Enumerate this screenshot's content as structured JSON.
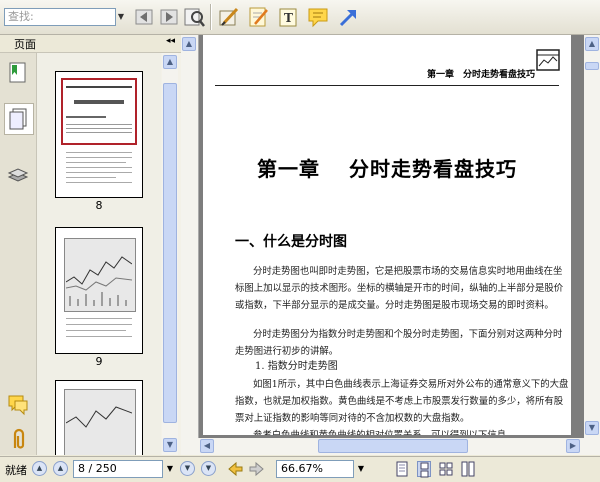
{
  "toolbar": {
    "search_placeholder": "查找:",
    "icons": [
      "search-prev-icon",
      "search-next-icon",
      "find-icon",
      "edit-tool-icon",
      "note-pad-icon",
      "text-tool-icon",
      "comment-icon",
      "arrow-tool-icon"
    ]
  },
  "sidebar": {
    "title": "页面",
    "collapse_glyph": "◂◂",
    "thumbnails": [
      {
        "label": "8"
      },
      {
        "label": "9"
      }
    ]
  },
  "document": {
    "running_header": "第一章　分时走势看盘技巧",
    "chapter_title": "第一章　 分时走势看盘技巧",
    "section_heading": "一、什么是分时图",
    "paragraphs": [
      "分时走势图也叫即时走势图，它是把股票市场的交易信息实时地用曲线在坐标图上加以显示的技术图形。坐标的横轴是开市的时间，纵轴的上半部分是股价或指数，下半部分显示的是成交量。分时走势图是股市现场交易的即时资料。",
      "分时走势图分为指数分时走势图和个股分时走势图，下面分别对这两种分时走势图进行初步的讲解。"
    ],
    "subheading": "1. 指数分时走势图",
    "paragraph3": "如图1所示，其中白色曲线表示上海证券交易所对外公布的通常意义下的大盘指数，也就是加权指数。黄色曲线是不考虑上市股票发行数量的多少，将所有股票对上证指数的影响等同对待的不含加权数的大盘指数。",
    "paragraph4": "参考白色曲线和黄色曲线的相对位置关系，可以得到以下信息"
  },
  "statusbar": {
    "status_label": "就绪",
    "page_indicator": "8 / 250",
    "zoom": "66.67%"
  },
  "colors": {
    "accent_blue": "#3a6fd8",
    "thumb_highlight": "#b0222a"
  }
}
